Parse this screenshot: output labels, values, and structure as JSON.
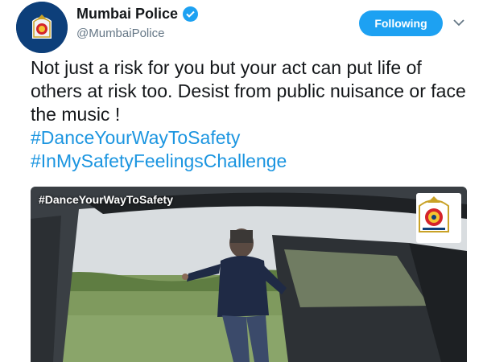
{
  "author": {
    "name": "Mumbai Police",
    "handle": "@MumbaiPolice",
    "verified": true,
    "avatar_icon": "mumbai-police-emblem"
  },
  "actions": {
    "follow_label": "Following",
    "more_icon": "chevron-down-icon"
  },
  "tweet": {
    "text": "Not just a risk for you but your act can put life of others at risk too. Desist from public nuisance or face the music !",
    "hashtags": [
      "#DanceYourWayToSafety",
      "#InMySafetyFeelingsChallenge"
    ]
  },
  "media": {
    "caption": "#DanceYourWayToSafety",
    "logo_icon": "mumbai-police-emblem"
  },
  "colors": {
    "brand_blue": "#1da1f2",
    "hashtag_blue": "#1b95e0",
    "emblem_navy": "#0d3f7a"
  }
}
